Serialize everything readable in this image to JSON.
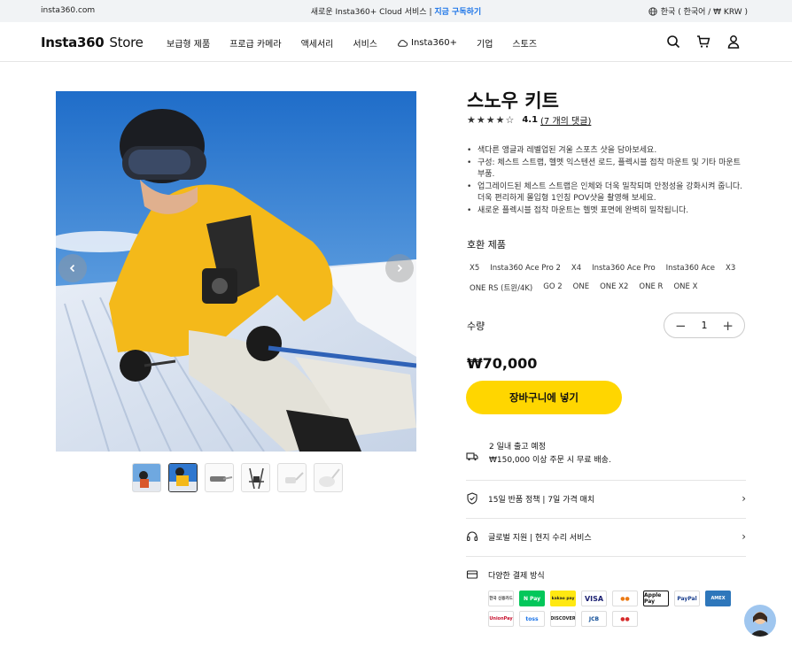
{
  "topbar": {
    "domain": "insta360.com",
    "promo_text": "새로운 Insta360+ Cloud 서비스 |",
    "promo_link": "지금 구독하기",
    "locale": "한국 ( 한국어 / ₩ KRW )"
  },
  "header": {
    "logo": "Insta360",
    "store": "Store",
    "nav": [
      "보급형 제품",
      "프로급 카메라",
      "액세서리",
      "서비스",
      "Insta360+",
      "기업",
      "스토즈"
    ]
  },
  "product": {
    "title": "스노우 키트",
    "score": "4.1",
    "reviews": "(7 개의 댓글)",
    "bullets": [
      "색다른 앵글과 레벨업된 겨울 스포츠 샷을 담아보세요.",
      "구성: 체스트 스트랩, 헬멧 익스텐션 로드, 플렉시블 접착 마운트 및 기타 마운트 부품.",
      "업그레이드된 체스트 스트랩은 인체와 더욱 밀착되며 안정성을 강화시켜 줍니다.더욱 편리하게 몰입형 1인칭 POV샷을 촬영해 보세요.",
      "새로운 플렉시블 접착 마운트는 헬멧 표면에 완벽히 밀착됩니다."
    ],
    "compat_title": "호환 제품",
    "compat": [
      "X5",
      "Insta360 Ace Pro 2",
      "X4",
      "Insta360 Ace Pro",
      "Insta360 Ace",
      "X3",
      "ONE RS (트윈/4K)",
      "GO 2",
      "ONE",
      "ONE X2",
      "ONE R",
      "ONE X"
    ],
    "qty_label": "수량",
    "qty_value": "1",
    "price": "₩70,000",
    "cart_button": "장바구니에 넣기",
    "ship_line1": "2 일내 출고 예정",
    "ship_line2": "₩150,000 이상 주문 시 무료 배송.",
    "policy1": "15일 반품 정책 | 7일 가격 매치",
    "policy2": "글로벌 지원 | 현지 수리 서비스",
    "payment_title": "다양한 결제 방식",
    "payments": [
      "한국 신용카드",
      "N Pay",
      "kakao pay",
      "VISA",
      "●●",
      "Apple Pay",
      "PayPal",
      "AMEX",
      "UnionPay",
      "toss",
      "DISCOVER",
      "JCB",
      "●●"
    ]
  },
  "colors": {
    "accent": "#ffd600",
    "link": "#1a73e8"
  }
}
